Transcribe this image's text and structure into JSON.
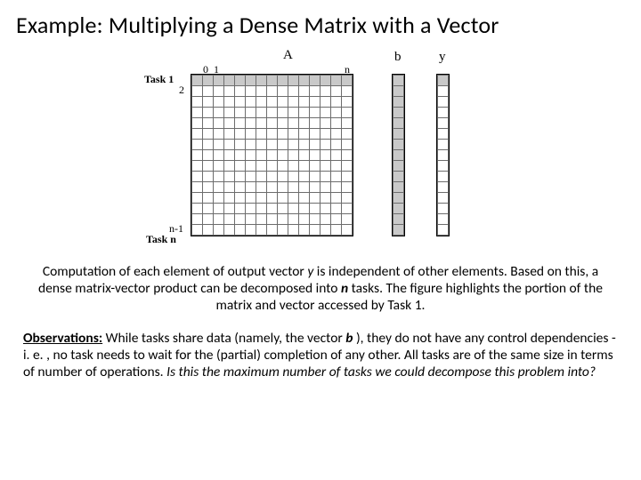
{
  "title": "Example: Multiplying a Dense Matrix with a Vector",
  "figure": {
    "labels": {
      "A": "A",
      "b": "b",
      "y": "y"
    },
    "indices": {
      "zero": "0",
      "one": "1",
      "n_col": "n",
      "task1": "Task 1",
      "two": "2",
      "nminus1": "n-1",
      "taskn": "Task n"
    },
    "gridSize": 15
  },
  "caption": {
    "t1": "Computation of each element of output vector ",
    "y": "y",
    "t2": " is independent of other elements. Based on this, a dense matrix-vector product can be decomposed into ",
    "n": "n",
    "t3": " tasks. The figure highlights the portion of the matrix and vector accessed by Task 1."
  },
  "observations": {
    "heading": "Observations:",
    "t1": " While tasks share data (namely, the vector ",
    "b": "b",
    "t2": " ), they do not have any control dependencies - i. e. , no task needs to wait for the (partial) completion of any other. All tasks are of the same size in terms of number of operations. ",
    "question": "Is this the maximum number of tasks we could decompose this problem into?"
  }
}
